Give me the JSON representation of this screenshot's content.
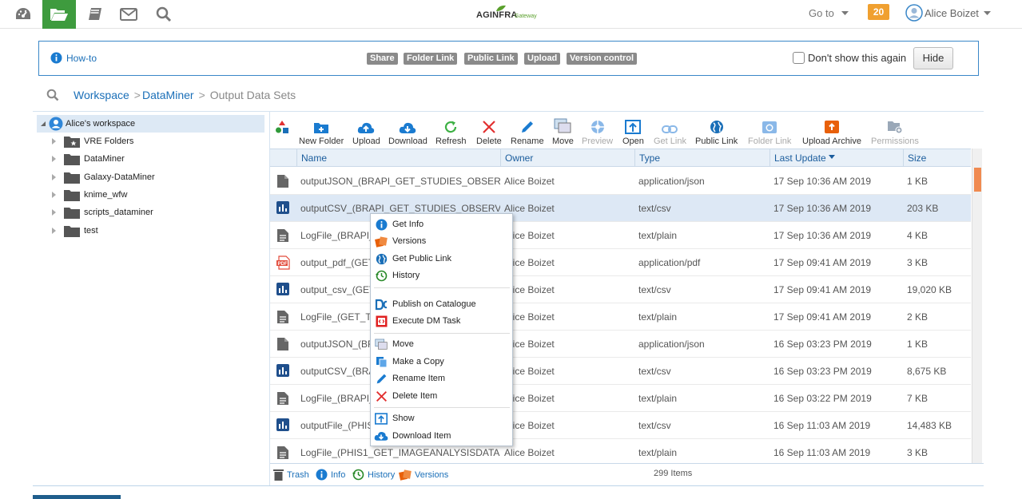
{
  "topbar": {
    "icons": [
      "dashboard-icon",
      "folder-open-icon",
      "book-icon",
      "mail-icon",
      "search-icon"
    ],
    "logo_text": "AGINFRA",
    "logo_sub": "Gateway",
    "goto_label": "Go to",
    "notification_count": "20",
    "user_name": "Alice Boizet"
  },
  "howto": {
    "label": "How-to",
    "tags": [
      "Share",
      "Folder Link",
      "Public Link",
      "Upload",
      "Version control"
    ],
    "dont_show_label": "Don't show this again",
    "hide_label": "Hide"
  },
  "breadcrumb": {
    "items": [
      "Workspace",
      "DataMiner",
      "Output Data Sets"
    ],
    "separator": ">"
  },
  "tree": {
    "root": "Alice's workspace",
    "items": [
      "VRE Folders",
      "DataMiner",
      "Galaxy-DataMiner",
      "knime_wfw",
      "scripts_dataminer",
      "test"
    ]
  },
  "toolbar": {
    "buttons": [
      {
        "label": "",
        "icon": "shapes-icon",
        "enabled": true
      },
      {
        "label": "New Folder",
        "icon": "new-folder-icon",
        "enabled": true
      },
      {
        "label": "Upload",
        "icon": "upload-icon",
        "enabled": true
      },
      {
        "label": "Download",
        "icon": "download-icon",
        "enabled": true
      },
      {
        "label": "Refresh",
        "icon": "refresh-icon",
        "enabled": true
      },
      {
        "label": "Delete",
        "icon": "delete-icon",
        "enabled": true
      },
      {
        "label": "Rename",
        "icon": "rename-icon",
        "enabled": true
      },
      {
        "label": "Move",
        "icon": "move-icon",
        "enabled": true
      },
      {
        "label": "Preview",
        "icon": "preview-icon",
        "enabled": false
      },
      {
        "label": "Open",
        "icon": "open-icon",
        "enabled": true
      },
      {
        "label": "Get Link",
        "icon": "link-icon",
        "enabled": false
      },
      {
        "label": "Public Link",
        "icon": "globe-icon",
        "enabled": true
      },
      {
        "label": "Folder Link",
        "icon": "folder-link-icon",
        "enabled": false
      },
      {
        "label": "Upload Archive",
        "icon": "upload-archive-icon",
        "enabled": true
      },
      {
        "label": "Permissions",
        "icon": "permissions-icon",
        "enabled": false
      }
    ]
  },
  "table": {
    "columns": [
      "Name",
      "Owner",
      "Type",
      "Last Update",
      "Size"
    ],
    "rows": [
      {
        "icon": "file-icon",
        "name": "outputJSON_(BRAPI_GET_STUDIES_OBSER...",
        "owner": "Alice Boizet",
        "type": "application/json",
        "updated": "17 Sep 10:36 AM 2019",
        "size": "1 KB"
      },
      {
        "icon": "csv-icon",
        "name": "outputCSV_(BRAPI_GET_STUDIES_OBSERVA...",
        "owner": "Alice Boizet",
        "type": "text/csv",
        "updated": "17 Sep 10:36 AM 2019",
        "size": "203 KB"
      },
      {
        "icon": "text-file-icon",
        "name": "LogFile_(BRAPI_",
        "owner": "Alice Boizet",
        "type": "text/plain",
        "updated": "17 Sep 10:36 AM 2019",
        "size": "4 KB"
      },
      {
        "icon": "pdf-icon",
        "name": "output_pdf_(GET",
        "owner": "Alice Boizet",
        "type": "application/pdf",
        "updated": "17 Sep 09:41 AM 2019",
        "size": "3 KB"
      },
      {
        "icon": "csv-icon",
        "name": "output_csv_(GET",
        "owner": "Alice Boizet",
        "type": "text/csv",
        "updated": "17 Sep 09:41 AM 2019",
        "size": "19,020 KB"
      },
      {
        "icon": "text-file-icon",
        "name": "LogFile_(GET_TI",
        "owner": "Alice Boizet",
        "type": "text/plain",
        "updated": "17 Sep 09:41 AM 2019",
        "size": "2 KB"
      },
      {
        "icon": "file-icon",
        "name": "outputJSON_(BF",
        "owner": "Alice Boizet",
        "type": "application/json",
        "updated": "16 Sep 03:23 PM 2019",
        "size": "1 KB"
      },
      {
        "icon": "csv-icon",
        "name": "outputCSV_(BRA",
        "owner": "Alice Boizet",
        "type": "text/csv",
        "updated": "16 Sep 03:23 PM 2019",
        "size": "8,675 KB"
      },
      {
        "icon": "text-file-icon",
        "name": "LogFile_(BRAPI_",
        "owner": "Alice Boizet",
        "type": "text/plain",
        "updated": "16 Sep 03:22 PM 2019",
        "size": "7 KB"
      },
      {
        "icon": "csv-icon",
        "name": "outputFile_(PHIS",
        "owner": "Alice Boizet",
        "type": "text/csv",
        "updated": "16 Sep 11:03 AM 2019",
        "size": "14,483 KB"
      },
      {
        "icon": "text-file-icon",
        "name": "LogFile_(PHIS1_GET_IMAGEANALYSISDATA...",
        "owner": "Alice Boizet",
        "type": "text/plain",
        "updated": "16 Sep 11:03 AM 2019",
        "size": "3 KB"
      }
    ]
  },
  "footer": {
    "trash": "Trash",
    "info": "Info",
    "history": "History",
    "versions": "Versions",
    "count": "299 Items"
  },
  "context_menu": {
    "items": [
      {
        "label": "Get Info",
        "icon": "info-icon"
      },
      {
        "label": "Versions",
        "icon": "versions-icon"
      },
      {
        "label": "Get Public Link",
        "icon": "globe-icon"
      },
      {
        "label": "History",
        "icon": "history-icon"
      },
      {
        "label": "Publish on Catalogue",
        "icon": "catalogue-icon"
      },
      {
        "label": "Execute DM Task",
        "icon": "execute-icon"
      },
      {
        "label": "Move",
        "icon": "move-icon"
      },
      {
        "label": "Make a Copy",
        "icon": "copy-icon"
      },
      {
        "label": "Rename Item",
        "icon": "rename-icon"
      },
      {
        "label": "Delete Item",
        "icon": "delete-icon"
      },
      {
        "label": "Show",
        "icon": "show-icon"
      },
      {
        "label": "Download Item",
        "icon": "download-icon"
      }
    ]
  },
  "colors": {
    "accent": "#1a6fb8",
    "active_nav": "#3e9b3e",
    "notification": "#f0a030",
    "selected_row": "#dde8f5"
  }
}
